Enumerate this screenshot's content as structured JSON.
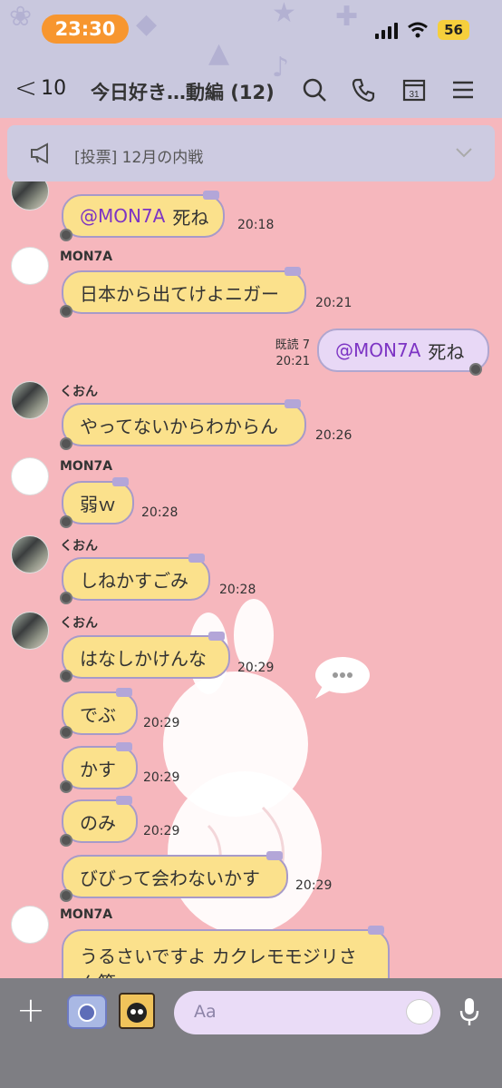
{
  "status_bar": {
    "time": "23:30",
    "battery": "56"
  },
  "header": {
    "back_count": "10",
    "title": "今日好き…動編 (12)",
    "calendar_day": "31"
  },
  "announcement": {
    "text": "[投票] 12月の内戦"
  },
  "messages": [
    {
      "sender": "",
      "text": "死ね",
      "mention": "@MON7A",
      "time": "20:18"
    },
    {
      "sender": "MON7A",
      "text": "日本から出てけよニガー",
      "time": "20:21"
    },
    {
      "own": true,
      "text": "死ね",
      "mention": "@MON7A",
      "read": "既読 7",
      "time": "20:21"
    },
    {
      "sender": "くおん",
      "text": "やってないからわからん",
      "time": "20:26"
    },
    {
      "sender": "MON7A",
      "text": "弱ｗ",
      "time": "20:28"
    },
    {
      "sender": "くおん",
      "text": "しねかすごみ",
      "time": "20:28"
    },
    {
      "sender": "くおん",
      "text": "はなしかけんな",
      "time": "20:29"
    },
    {
      "text": "でぶ",
      "time": "20:29"
    },
    {
      "text": "かす",
      "time": "20:29"
    },
    {
      "text": "のみ",
      "time": "20:29"
    },
    {
      "text": "びびって会わないかす",
      "time": "20:29"
    },
    {
      "sender": "MON7A",
      "text": "うるさいですよ カクレモモジリさん等"
    }
  ],
  "input": {
    "placeholder": "Aa"
  }
}
